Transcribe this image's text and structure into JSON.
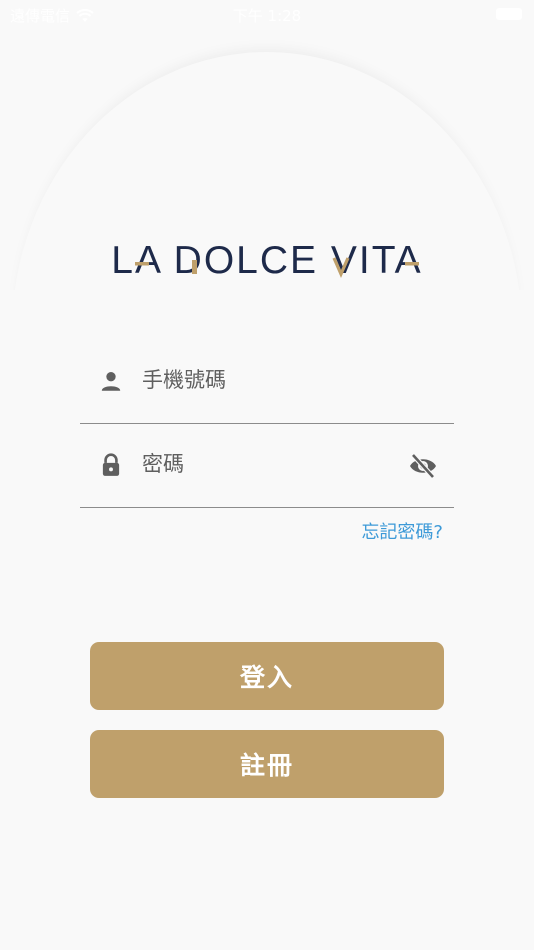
{
  "status_bar": {
    "carrier": "遠傳電信",
    "time": "下午 1:28",
    "wifi_icon": "wifi-icon",
    "battery_icon": "battery-icon"
  },
  "logo": {
    "text": "LA DOLCE VITA",
    "primary_color": "#1e2a4a",
    "accent_color": "#bfa06b"
  },
  "form": {
    "phone": {
      "placeholder": "手機號碼",
      "value": "",
      "icon": "person-icon"
    },
    "password": {
      "placeholder": "密碼",
      "value": "",
      "icon": "lock-icon",
      "toggle_icon": "eye-off-icon"
    },
    "forgot_password": "忘記密碼?"
  },
  "buttons": {
    "login": "登入",
    "register": "註冊"
  },
  "colors": {
    "button": "#bfa06b",
    "link": "#3d9ad8",
    "icon": "#5f5f5f",
    "background": "#f9f9f9"
  }
}
